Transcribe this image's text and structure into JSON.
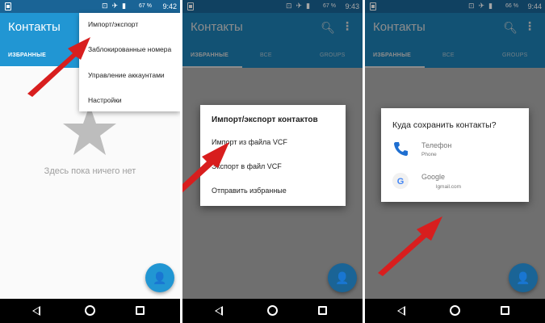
{
  "screens": [
    {
      "status": {
        "battery_pct": "67 %",
        "time": "9:42"
      },
      "app_title": "Контакты",
      "tabs": [
        "ИЗБРАННЫЕ"
      ],
      "menu_items": [
        "Импорт/экспорт",
        "Заблокированные номера",
        "Управление аккаунтами",
        "Настройки"
      ],
      "empty_text": "Здесь пока ничего нет"
    },
    {
      "status": {
        "battery_pct": "67 %",
        "time": "9:43"
      },
      "app_title": "Контакты",
      "tabs": [
        "ИЗБРАННЫЕ",
        "ВСЕ",
        "GROUPS"
      ],
      "dialog": {
        "title": "Импорт/экспорт контактов",
        "items": [
          "Импорт из файла VCF",
          "Экспорт в файл VCF",
          "Отправить избранные"
        ]
      }
    },
    {
      "status": {
        "battery_pct": "66 %",
        "time": "9:44"
      },
      "app_title": "Контакты",
      "tabs": [
        "ИЗБРАННЫЕ",
        "ВСЕ",
        "GROUPS"
      ],
      "dialog": {
        "title": "Куда сохранить контакты?",
        "accounts": [
          {
            "name": "Телефон",
            "sub": "Phone",
            "icon": "phone-icon"
          },
          {
            "name": "Google",
            "sub": "lgmail.com",
            "icon": "google-icon"
          }
        ]
      }
    }
  ],
  "colors": {
    "appbar": "#2196d3",
    "statusbar": "#1a6496",
    "arrow": "#d81e1e",
    "fab": "#2196d3"
  }
}
